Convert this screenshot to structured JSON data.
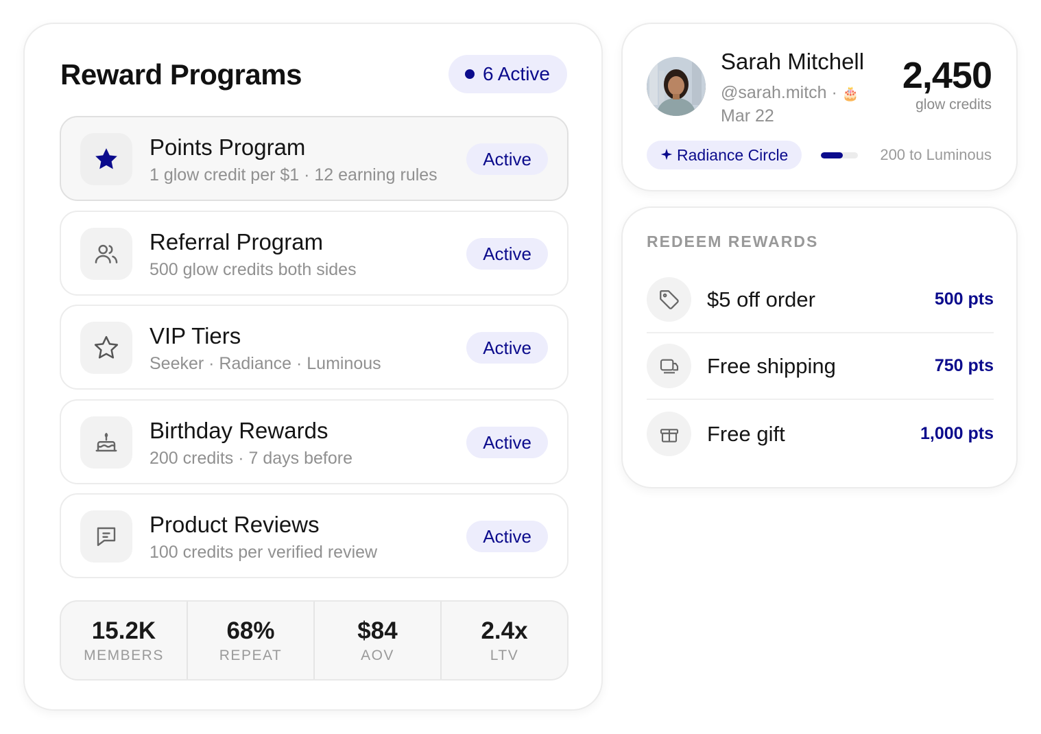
{
  "programs_panel": {
    "title": "Reward Programs",
    "active_count_label": "6 Active",
    "programs": [
      {
        "name": "Points Program",
        "subtitle": "1 glow credit per $1 · 12 earning rules",
        "status": "Active",
        "icon": "star-filled-icon"
      },
      {
        "name": "Referral Program",
        "subtitle": "500 glow credits both sides",
        "status": "Active",
        "icon": "users-icon"
      },
      {
        "name": "VIP Tiers",
        "subtitle": "Seeker · Radiance · Luminous",
        "status": "Active",
        "icon": "star-outline-icon"
      },
      {
        "name": "Birthday Rewards",
        "subtitle": "200 credits · 7 days before",
        "status": "Active",
        "icon": "cake-icon"
      },
      {
        "name": "Product Reviews",
        "subtitle": "100 credits per verified review",
        "status": "Active",
        "icon": "message-icon"
      }
    ],
    "stats": [
      {
        "value": "15.2K",
        "label": "MEMBERS"
      },
      {
        "value": "68%",
        "label": "REPEAT"
      },
      {
        "value": "$84",
        "label": "AOV"
      },
      {
        "value": "2.4x",
        "label": "LTV"
      }
    ]
  },
  "profile": {
    "name": "Sarah Mitchell",
    "handle": "@sarah.mitch ·",
    "birthday_icon": "🎂",
    "birthday": "Mar 22",
    "credits": "2,450",
    "credits_label": "glow credits",
    "tier": "Radiance Circle",
    "tier_icon": "sparkle-icon",
    "progress_fraction": 0.6,
    "progress_text": "200 to Luminous"
  },
  "redeem": {
    "title": "REDEEM REWARDS",
    "rewards": [
      {
        "name": "$5 off order",
        "points": "500 pts",
        "icon": "tag-icon"
      },
      {
        "name": "Free shipping",
        "points": "750 pts",
        "icon": "shipping-icon"
      },
      {
        "name": "Free gift",
        "points": "1,000 pts",
        "icon": "gift-icon"
      }
    ]
  },
  "colors": {
    "accent": "#0b0b8c",
    "badge_bg": "#ededfc",
    "muted_text": "#909090"
  }
}
